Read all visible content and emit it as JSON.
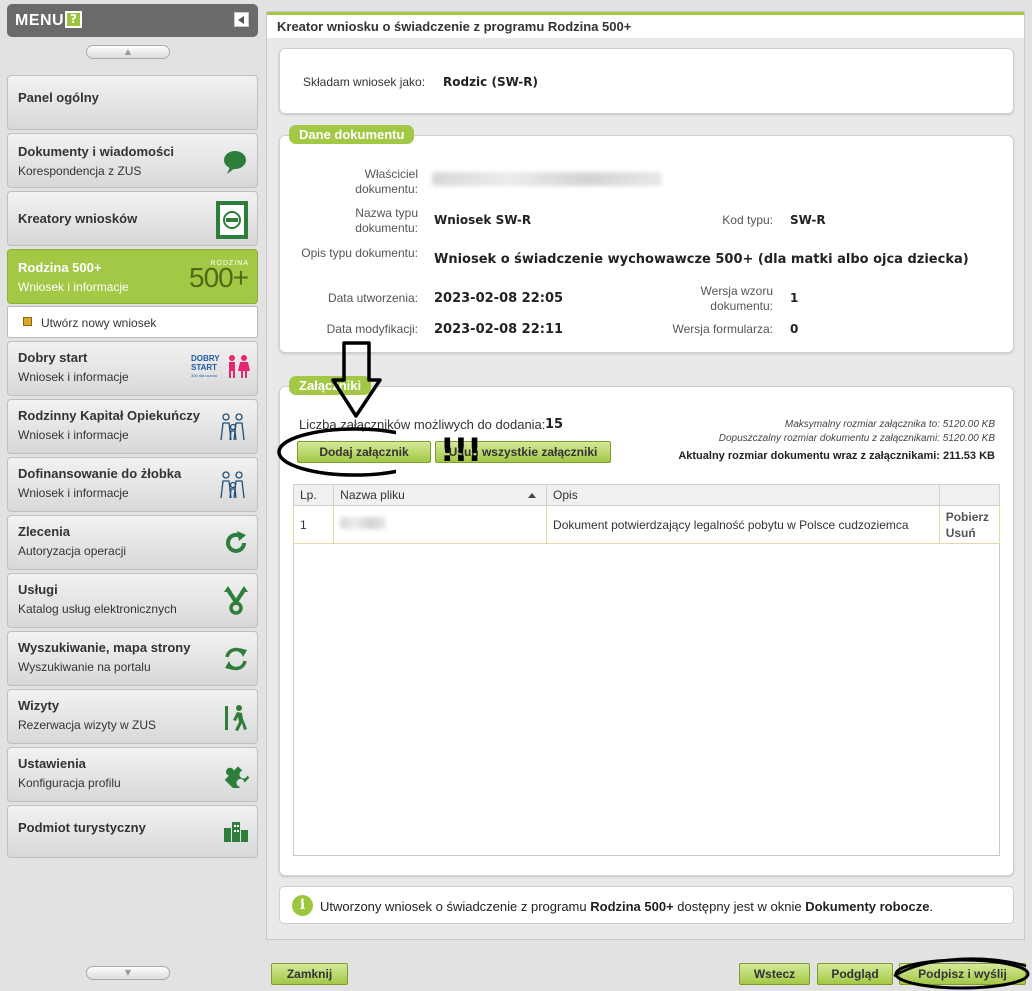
{
  "menu": {
    "title": "MENU",
    "help": "?",
    "items": [
      {
        "title": "Panel ogólny",
        "subtitle": ""
      },
      {
        "title": "Dokumenty i wiadomości",
        "subtitle": "Korespondencja z ZUS"
      },
      {
        "title": "Kreatory wniosków",
        "subtitle": ""
      },
      {
        "title": "Rodzina 500+",
        "subtitle": "Wniosek i informacje"
      },
      {
        "title": "Dobry start",
        "subtitle": "Wniosek i informacje"
      },
      {
        "title": "Rodzinny Kapitał Opiekuńczy",
        "subtitle": "Wniosek i informacje"
      },
      {
        "title": "Dofinansowanie do żłobka",
        "subtitle": "Wniosek i informacje"
      },
      {
        "title": "Zlecenia",
        "subtitle": "Autoryzacja operacji"
      },
      {
        "title": "Usługi",
        "subtitle": "Katalog usług elektronicznych"
      },
      {
        "title": "Wyszukiwanie, mapa strony",
        "subtitle": "Wyszukiwanie na portalu"
      },
      {
        "title": "Wizyty",
        "subtitle": "Rezerwacja wizyty w ZUS"
      },
      {
        "title": "Ustawienia",
        "subtitle": "Konfiguracja profilu"
      },
      {
        "title": "Podmiot turystyczny",
        "subtitle": ""
      }
    ],
    "subitem": "Utwórz nowy wniosek",
    "logo_500": {
      "top": "RODZINA",
      "main": "500+"
    },
    "logo_dobry_start": {
      "line1": "DOBRY",
      "line2": "START",
      "line3": "300 dla ucznia"
    }
  },
  "main": {
    "title": "Kreator wniosku o świadczenie z programu Rodzina 500+",
    "applicant_label": "Składam wniosek jako:",
    "applicant_value": "Rodzic (SW-R)",
    "doc_section": "Dane dokumentu",
    "doc": {
      "owner_label": "Właściciel dokumentu:",
      "type_label": "Nazwa typu dokumentu:",
      "type_value": "Wniosek SW-R",
      "code_label": "Kod typu:",
      "code_value": "SW-R",
      "desc_label": "Opis typu dokumentu:",
      "desc_value": "Wniosek o świadczenie wychowawcze 500+ (dla matki albo ojca dziecka)",
      "created_label": "Data utworzenia:",
      "created_value": "2023-02-08 22:05",
      "template_label": "Wersja wzoru dokumentu:",
      "template_value": "1",
      "modified_label": "Data modyfikacji:",
      "modified_value": "2023-02-08 22:11",
      "form_label": "Wersja formularza:",
      "form_value": "0"
    },
    "att_section": "Załączniki",
    "att": {
      "count_label": "Liczba załączników możliwych do dodania:",
      "count_value": "15",
      "max_size": "Maksymalny rozmiar załącznika to: 5120.00 KB",
      "allowed_size": "Dopuszczalny rozmiar dokumentu z załącznikami: 5120.00 KB",
      "current_size": "Aktualny rozmiar dokumentu wraz z załącznikami: 211.53 KB",
      "add_button": "Dodaj załącznik",
      "remove_all_button": "Usuń wszystkie załączniki",
      "columns": [
        "Lp.",
        "Nazwa pliku",
        "Opis",
        ""
      ],
      "rows": [
        {
          "lp": "1",
          "desc": "Dokument potwierdzający legalność pobytu w Polsce cudzoziemca",
          "download": "Pobierz",
          "delete": "Usuń"
        }
      ]
    },
    "info": {
      "icon": "i",
      "pre": "Utworzony wniosek o świadczenie z programu ",
      "b1": "Rodzina 500+",
      "mid": " dostępny jest w oknie ",
      "b2": "Dokumenty robocze",
      "post": "."
    }
  },
  "footer": {
    "close": "Zamknij",
    "back": "Wstecz",
    "preview": "Podgląd",
    "sign_send": "Podpisz i wyślij"
  },
  "annotation": {
    "exclaim": "!!!"
  },
  "colors": {
    "accent": "#a3c846",
    "accent_dark": "#7e9d2c",
    "sidebar_header": "#6a6a6a",
    "icon_green": "#2e7d3a"
  }
}
